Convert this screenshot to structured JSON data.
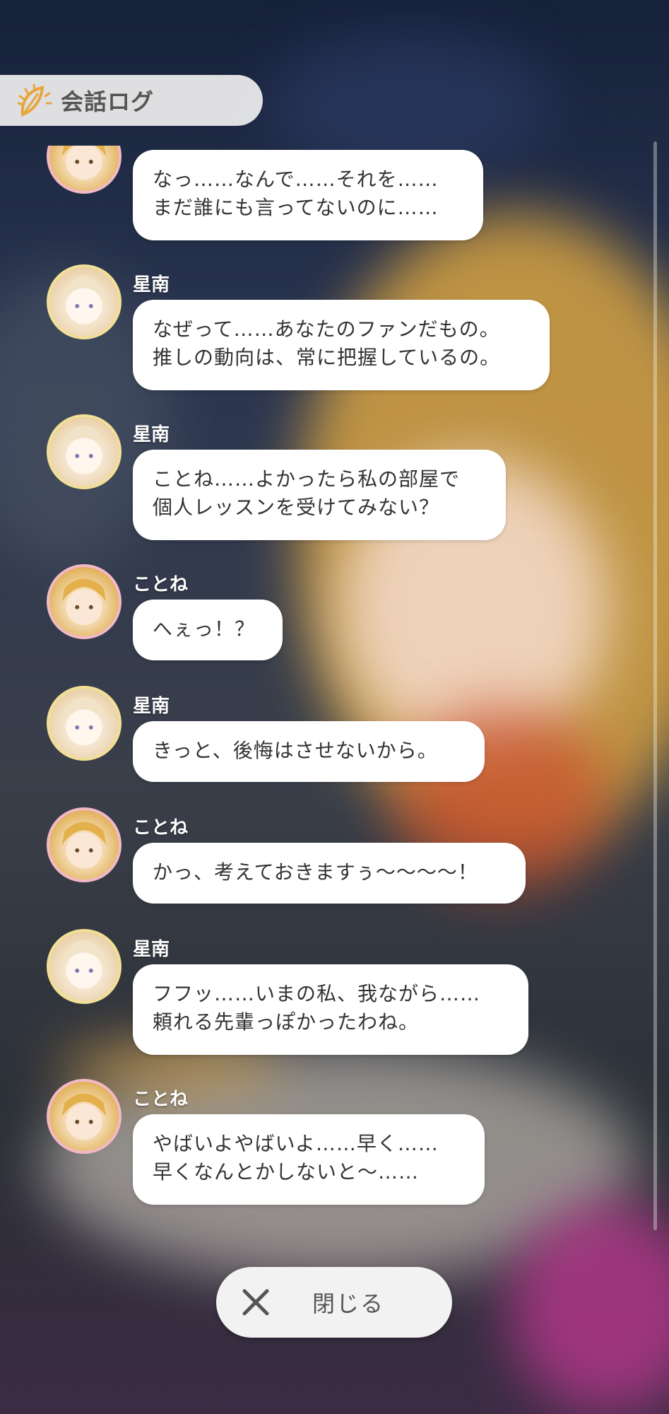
{
  "header": {
    "title": "会話ログ",
    "icon": "sun-leaf-logo-icon"
  },
  "messages": [
    {
      "speaker": "",
      "avatar": "kotone",
      "lines": [
        "なっ……なんで……それを……",
        "まだ誰にも言ってないのに……"
      ]
    },
    {
      "speaker": "星南",
      "avatar": "seinan",
      "lines": [
        "なぜって……あなたのファンだもの。",
        "推しの動向は、常に把握しているの。"
      ]
    },
    {
      "speaker": "星南",
      "avatar": "seinan",
      "lines": [
        "ことね……よかったら私の部屋で",
        "個人レッスンを受けてみない？"
      ]
    },
    {
      "speaker": "ことね",
      "avatar": "kotone",
      "lines": [
        "へぇっ！？"
      ]
    },
    {
      "speaker": "星南",
      "avatar": "seinan",
      "lines": [
        "きっと、後悔はさせないから。"
      ]
    },
    {
      "speaker": "ことね",
      "avatar": "kotone",
      "lines": [
        "かっ、考えておきますぅ～～～～！"
      ]
    },
    {
      "speaker": "星南",
      "avatar": "seinan",
      "lines": [
        "フフッ……いまの私、我ながら……",
        "頼れる先輩っぽかったわね。"
      ]
    },
    {
      "speaker": "ことね",
      "avatar": "kotone",
      "lines": [
        "やばいよやばいよ……早く……",
        "早くなんとかしないと～……"
      ]
    }
  ],
  "close_button": {
    "label": "閉じる",
    "icon": "close-x-icon"
  },
  "colors": {
    "accent": "#e8a53a",
    "bubble": "#ffffff",
    "text": "#333333"
  }
}
